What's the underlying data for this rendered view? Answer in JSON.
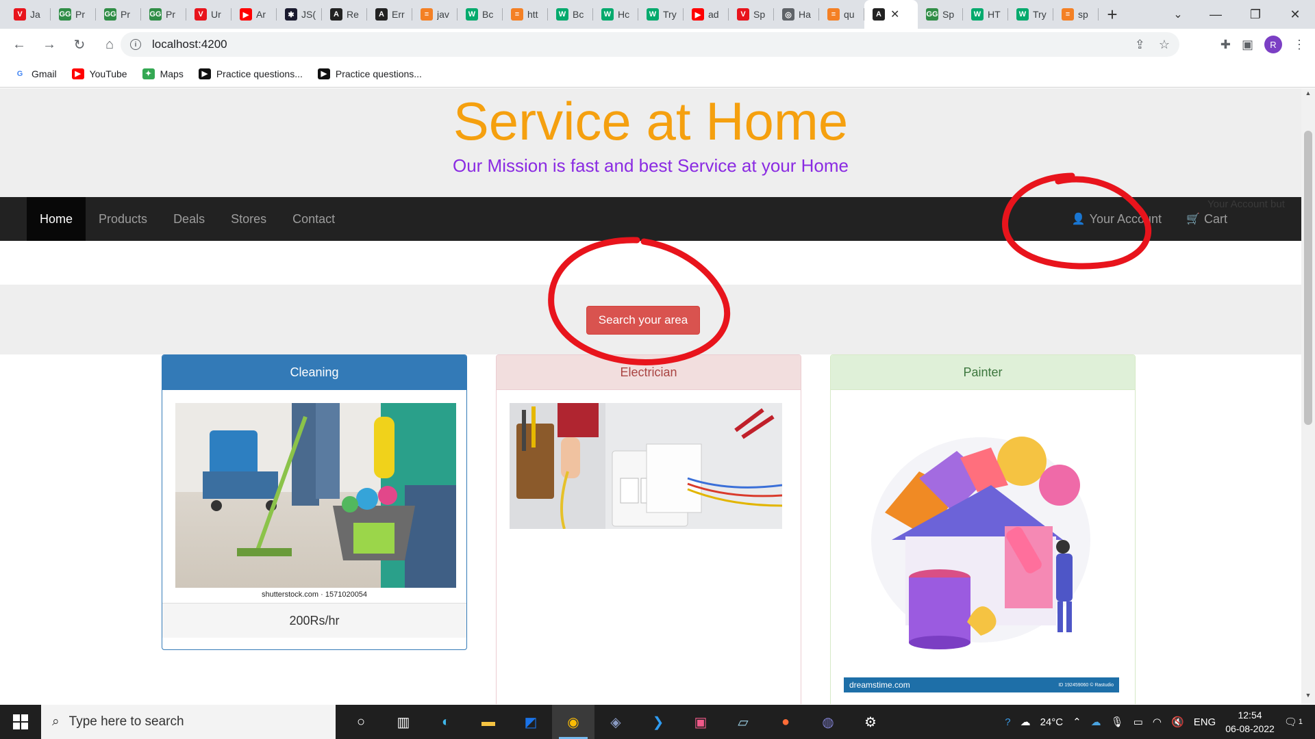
{
  "browser": {
    "tabs": [
      {
        "label": "Ja",
        "icon": "v-icon",
        "color": "#e8141c"
      },
      {
        "label": "Pr",
        "icon": "gfg-icon",
        "color": "#2f8d46"
      },
      {
        "label": "Pr",
        "icon": "gfg-icon",
        "color": "#2f8d46"
      },
      {
        "label": "Pr",
        "icon": "gfg-icon",
        "color": "#2f8d46"
      },
      {
        "label": "Ur",
        "icon": "v-icon",
        "color": "#e8141c"
      },
      {
        "label": "Ar",
        "icon": "youtube-icon",
        "color": "#ff0000"
      },
      {
        "label": "JS(",
        "icon": "jsc-icon",
        "color": "#1a1a2e"
      },
      {
        "label": "Re",
        "icon": "angular-icon",
        "color": "#222222"
      },
      {
        "label": "Err",
        "icon": "angular-icon",
        "color": "#222222"
      },
      {
        "label": "jav",
        "icon": "stack-icon",
        "color": "#f48024"
      },
      {
        "label": "Bc",
        "icon": "w3-icon",
        "color": "#04aa6d"
      },
      {
        "label": "htt",
        "icon": "stack-icon",
        "color": "#f48024"
      },
      {
        "label": "Bc",
        "icon": "w3-icon",
        "color": "#04aa6d"
      },
      {
        "label": "Hc",
        "icon": "w3-icon",
        "color": "#04aa6d"
      },
      {
        "label": "Try",
        "icon": "w3-icon",
        "color": "#04aa6d"
      },
      {
        "label": "ad",
        "icon": "youtube-icon",
        "color": "#ff0000"
      },
      {
        "label": "Sp",
        "icon": "v-icon",
        "color": "#e8141c"
      },
      {
        "label": "Ha",
        "icon": "globe-icon",
        "color": "#5f6368"
      },
      {
        "label": "qu",
        "icon": "stack-icon",
        "color": "#f48024"
      },
      {
        "label": "",
        "icon": "angular-icon",
        "color": "#222222",
        "active": true
      },
      {
        "label": "Sp",
        "icon": "gfg-icon",
        "color": "#2f8d46"
      },
      {
        "label": "HT",
        "icon": "w3-icon",
        "color": "#04aa6d"
      },
      {
        "label": "Try",
        "icon": "w3-icon",
        "color": "#04aa6d"
      },
      {
        "label": "sp",
        "icon": "stack-icon",
        "color": "#f48024"
      }
    ],
    "url": "localhost:4200",
    "profile_initial": "R",
    "bookmarks": [
      {
        "label": "Gmail",
        "icon": "google-icon"
      },
      {
        "label": "YouTube",
        "icon": "youtube-icon"
      },
      {
        "label": "Maps",
        "icon": "maps-icon"
      },
      {
        "label": "Practice questions...",
        "icon": "practice-icon"
      },
      {
        "label": "Practice questions...",
        "icon": "practice-icon"
      }
    ]
  },
  "page": {
    "title": "Service at Home",
    "mission": "Our Mission is fast and best Service at your Home",
    "nav": {
      "left": [
        "Home",
        "Products",
        "Deals",
        "Stores",
        "Contact"
      ],
      "active": "Home",
      "account": "Your Account",
      "cart": "Cart",
      "ghost_text": "Your Account but"
    },
    "search_button": "Search your area",
    "cards": {
      "cleaning": {
        "title": "Cleaning",
        "image_caption": "shutterstock.com · 1571020054",
        "price": "200Rs/hr"
      },
      "electrician": {
        "title": "Electrician"
      },
      "painter": {
        "title": "Painter",
        "watermark": "dreamstime.com",
        "watermark_id": "ID 192459060 © Rastudio"
      }
    },
    "colors": {
      "title": "#f5a00f",
      "mission": "#8a2be2",
      "navbar": "#222222",
      "danger": "#d9534f",
      "primary": "#337ab7",
      "annotation": "#e8141c"
    }
  },
  "taskbar": {
    "search_placeholder": "Type here to search",
    "weather": "24°C",
    "language": "ENG",
    "time": "12:54",
    "date": "06-08-2022",
    "notification_count": "1"
  }
}
